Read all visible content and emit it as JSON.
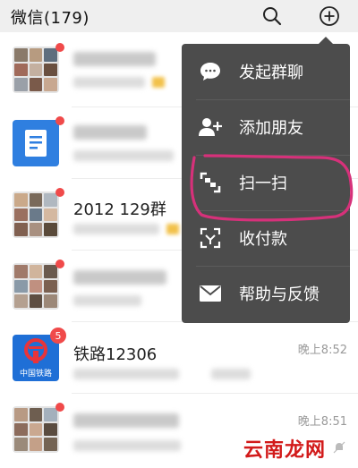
{
  "header": {
    "title": "微信(179)",
    "search_icon": "search-icon",
    "plus_icon": "plus-circle-icon"
  },
  "chats": [
    {
      "kind": "group",
      "name": "",
      "time": "",
      "badge": "",
      "dot": true
    },
    {
      "kind": "doc",
      "name": "",
      "time": "",
      "badge": "",
      "dot": true
    },
    {
      "kind": "group",
      "name": "2012 129群",
      "time": "",
      "badge": "",
      "dot": true
    },
    {
      "kind": "group",
      "name": "",
      "time": "",
      "badge": "",
      "dot": true
    },
    {
      "kind": "railway",
      "name": "铁路12306",
      "time": "晚上8:52",
      "badge": "5",
      "avatar_label": "中国铁路",
      "dot": false
    },
    {
      "kind": "group",
      "name": "",
      "time": "晚上8:51",
      "badge": "",
      "dot": true
    }
  ],
  "menu": {
    "items": [
      {
        "label": "发起群聊",
        "icon": "chat-bubble-icon"
      },
      {
        "label": "添加朋友",
        "icon": "add-friend-icon"
      },
      {
        "label": "扫一扫",
        "icon": "scan-icon"
      },
      {
        "label": "收付款",
        "icon": "payment-icon"
      },
      {
        "label": "帮助与反馈",
        "icon": "mail-icon"
      }
    ]
  },
  "watermark": {
    "text": "云南龙网"
  },
  "colors": {
    "menu_bg": "#4c4c4c",
    "header_bg": "#efefef",
    "badge": "#f04a4a",
    "annotation": "#d6317a",
    "doc_avatar": "#2f7fe0",
    "railway_avatar": "#1f6fd6"
  }
}
